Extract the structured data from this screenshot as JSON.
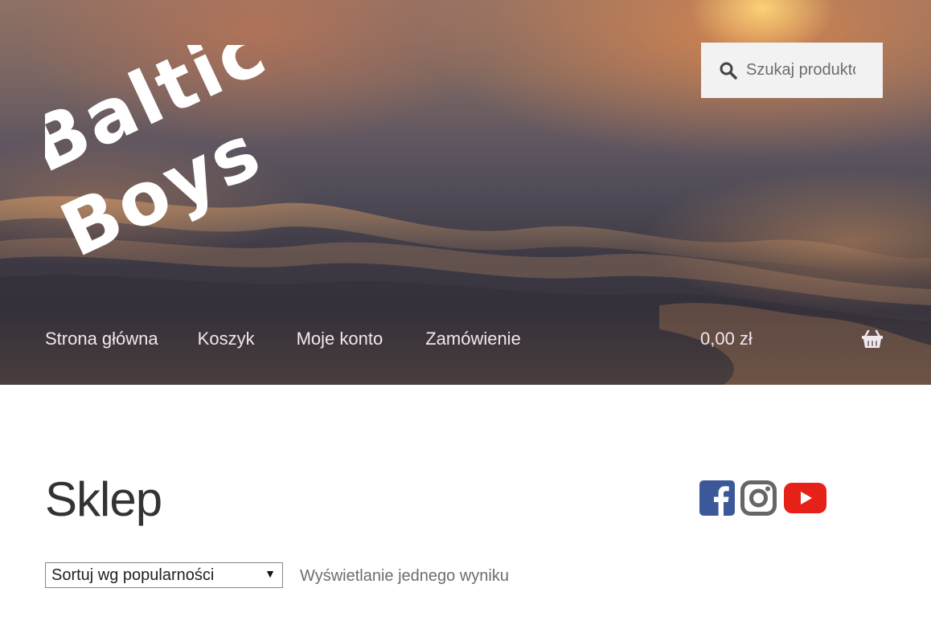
{
  "header": {
    "logo": {
      "line1": "Baltic",
      "line2": "Boys"
    },
    "search": {
      "placeholder": "Szukaj produktów…"
    },
    "nav": [
      {
        "label": "Strona główna"
      },
      {
        "label": "Koszyk"
      },
      {
        "label": "Moje konto"
      },
      {
        "label": "Zamówienie"
      }
    ],
    "cart": {
      "amount": "0,00 zł",
      "icon": "basket-icon"
    }
  },
  "main": {
    "title": "Sklep",
    "social": [
      {
        "icon": "facebook-icon",
        "color": "#3b5998"
      },
      {
        "icon": "instagram-icon",
        "color": "#666666"
      },
      {
        "icon": "youtube-icon",
        "color": "#e62117"
      }
    ],
    "sort": {
      "selected": "Sortuj wg popularności"
    },
    "result_count": "Wyświetlanie jednego wyniku"
  }
}
